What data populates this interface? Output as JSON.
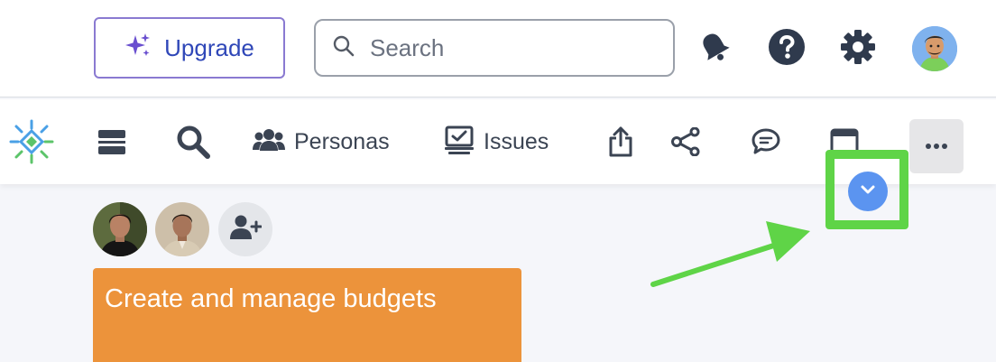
{
  "header": {
    "upgrade_label": "Upgrade",
    "search_placeholder": "Search"
  },
  "toolbar": {
    "personas_label": "Personas",
    "issues_label": "Issues"
  },
  "card": {
    "title": "Create and manage budgets"
  },
  "icons": {
    "upgrade": "sparkles-icon",
    "search": "search-icon",
    "notifications": "bell-icon",
    "help": "question-circle-icon",
    "settings": "gear-icon",
    "logo": "app-logo-icon",
    "menu": "menu-icon",
    "zoom": "magnifier-icon",
    "personas": "users-icon",
    "issues": "issues-icon",
    "share": "share-icon",
    "connect": "share-nodes-icon",
    "comments": "comment-icon",
    "window": "window-icon",
    "more": "ellipsis-icon",
    "add_collaborator": "user-plus-icon",
    "expand": "chevron-down-icon"
  },
  "colors": {
    "accent_blue": "#2f47b8",
    "upgrade_border": "#8a7ad1",
    "card_orange": "#ec933b",
    "annotation_green": "#5fd447",
    "expand_blue": "#5b94f0"
  }
}
